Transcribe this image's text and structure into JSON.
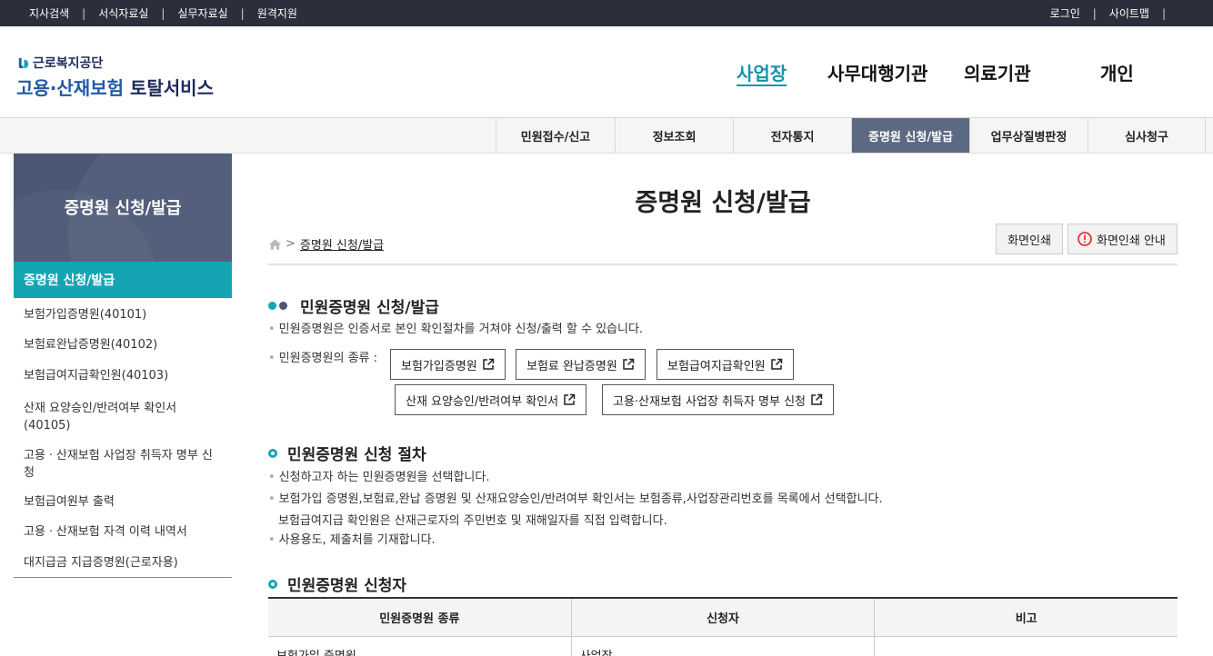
{
  "utility": {
    "left": [
      "지사검색",
      "서식자료실",
      "실무자료실",
      "원격지원"
    ],
    "right": [
      "로그인",
      "사이트맵"
    ]
  },
  "logo": {
    "org": "근로복지공단",
    "service_blue": "고용·산재보험",
    "service_dark": " 토탈서비스"
  },
  "gnb": [
    "사업장",
    "사무대행기관",
    "의료기관",
    "개인"
  ],
  "submenu": [
    "민원접수/신고",
    "정보조회",
    "전자통지",
    "증명원 신청/발급",
    "업무상질병판정",
    "심사청구"
  ],
  "lnb": {
    "title": "증명원 신청/발급",
    "active": "증명원 신청/발급",
    "items": [
      "보험가입증명원(40101)",
      "보험료완납증명원(40102)",
      "보험급여지급확인원(40103)",
      "산재 요양승인/반려여부 확인서(40105)",
      "고용ㆍ산재보험 사업장 취득자 명부 신청",
      "보험급여원부 출력",
      "고용ㆍ산재보험 자격 이력 내역서",
      "대지급금 지급증명원(근로자용)"
    ]
  },
  "content": {
    "title": "증명원 신청/발급",
    "breadcrumb": "증명원 신청/발급",
    "print": "화면인쇄",
    "print_guide": "화면인쇄 안내",
    "sec1": {
      "title": "민원증명원 신청/발급",
      "desc": "민원증명원은 인증서로 본인 확인절차를 거쳐야 신청/출력 할 수 있습니다.",
      "kinds_label": "민원증명원의 종류 :",
      "buttons": [
        "보험가입증명원",
        "보험료 완납증명원",
        "보험급여지급확인원",
        "산재 요양승인/반려여부 확인서",
        "고용·산재보험 사업장 취득자 명부 신청"
      ]
    },
    "sec2": {
      "title": "민원증명원 신청 절차",
      "step1": "신청하고자 하는 민원증명원을 선택합니다.",
      "step2a": "보험가입 증명원,보험료,완납 증명원 및 산재요양승인/반려여부 확인서는 보험종류,사업장관리번호를 목록에서 선택합니다.",
      "step2b": "보험급여지급 확인원은 산재근로자의 주민번호 및 재해일자를 직접 입력합니다.",
      "step3": "사용용도, 제출처를 기재합니다."
    },
    "sec3": {
      "title": "민원증명원 신청자",
      "headers": [
        "민원증명원 종류",
        "신청자",
        "비고"
      ],
      "row1": [
        "보험가입 증명원",
        "사업장",
        ""
      ]
    }
  },
  "colors": {
    "accent": "#15a5b2",
    "nav_dark": "#4b5774",
    "tab_active": "#5b6a82",
    "utility_bg": "#2b2f3b"
  }
}
